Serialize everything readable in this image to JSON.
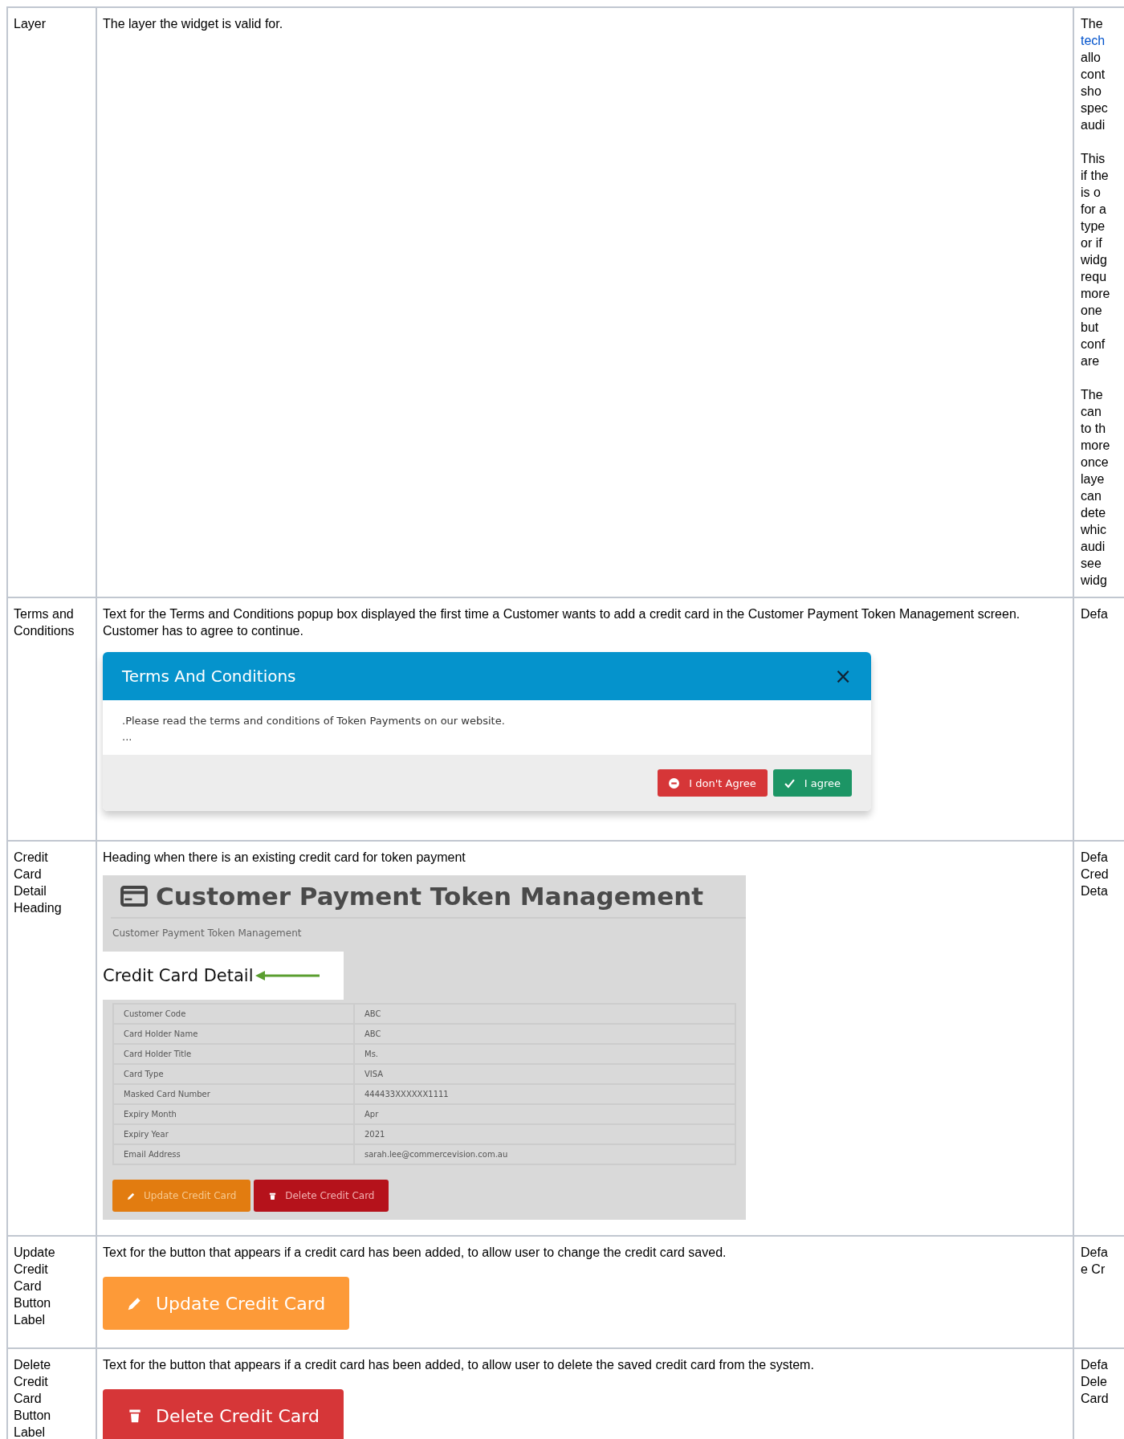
{
  "rows": [
    {
      "name": "Layer",
      "description": "The layer the widget is valid for.",
      "notes": [
        [
          {
            "text": "The",
            "link": false
          },
          {
            "text": "tech",
            "link": true
          },
          {
            "text": "allo",
            "link": false
          },
          {
            "text": "cont",
            "link": false
          },
          {
            "text": "sho",
            "link": false
          },
          {
            "text": "spec",
            "link": false
          },
          {
            "text": "audi",
            "link": false
          }
        ],
        [
          {
            "text": "This",
            "link": false
          },
          {
            "text": "if the",
            "link": false
          },
          {
            "text": "is o",
            "link": false
          },
          {
            "text": "for a",
            "link": false
          },
          {
            "text": "type",
            "link": false
          },
          {
            "text": "or if",
            "link": false
          },
          {
            "text": "widg",
            "link": false
          },
          {
            "text": "requ",
            "link": false
          },
          {
            "text": "more",
            "link": false
          },
          {
            "text": "one",
            "link": false
          },
          {
            "text": "but",
            "link": false
          },
          {
            "text": "conf",
            "link": false
          },
          {
            "text": "are",
            "link": false
          }
        ],
        [
          {
            "text": "The",
            "link": false
          },
          {
            "text": "can",
            "link": false
          },
          {
            "text": "to th",
            "link": false
          },
          {
            "text": "more",
            "link": false
          },
          {
            "text": "once",
            "link": false
          },
          {
            "text": "laye",
            "link": false
          },
          {
            "text": "can",
            "link": false
          },
          {
            "text": "dete",
            "link": false
          },
          {
            "text": "whic",
            "link": false
          },
          {
            "text": "audi",
            "link": false
          },
          {
            "text": "see",
            "link": false
          },
          {
            "text": "widg",
            "link": false
          }
        ]
      ]
    },
    {
      "name": "Terms and Conditions",
      "description": "Text for the Terms and Conditions popup box displayed the first time a Customer wants to add a credit card in the Customer Payment Token Management screen. Customer has to agree to continue.",
      "notes": [
        [
          {
            "text": "Defa",
            "link": false
          }
        ]
      ],
      "example": {
        "kind": "terms",
        "title": "Terms And Conditions",
        "close": "×",
        "body": ".Please read the terms and conditions of Token Payments on our website.",
        "body_more": "...",
        "buttons": [
          {
            "kind": "decline",
            "label": "I don't Agree"
          },
          {
            "kind": "accept",
            "label": "I agree"
          }
        ]
      }
    },
    {
      "name": "Credit Card Detail Heading",
      "description": "Heading when there is an existing credit card for token payment",
      "notes": [
        [
          {
            "text": "Defa",
            "link": false
          },
          {
            "text": "Cred",
            "link": false
          },
          {
            "text": "Deta",
            "link": false
          }
        ]
      ],
      "example": {
        "kind": "detail",
        "title": "Customer Payment Token Management",
        "breadcrumb": "Customer Payment Token Management",
        "heading": "Credit Card Detail",
        "fields": [
          {
            "label": "Customer Code",
            "value": "ABC"
          },
          {
            "label": "Card Holder Name",
            "value": "ABC"
          },
          {
            "label": "Card Holder Title",
            "value": "Ms."
          },
          {
            "label": "Card Type",
            "value": "VISA"
          },
          {
            "label": "Masked Card Number",
            "value": "444433XXXXXX1111"
          },
          {
            "label": "Expiry Month",
            "value": "Apr"
          },
          {
            "label": "Expiry Year",
            "value": "2021"
          },
          {
            "label": "Email Address",
            "value": "sarah.lee@commercevision.com.au"
          }
        ],
        "buttons": [
          {
            "kind": "update",
            "label": "Update Credit Card"
          },
          {
            "kind": "delete",
            "label": "Delete Credit Card"
          }
        ]
      }
    },
    {
      "name": "Update Credit Card Button Label",
      "description": "Text for the button that appears if a credit card has been added, to allow user to change the credit card saved.",
      "notes": [
        [
          {
            "text": "Defa",
            "link": false
          },
          {
            "text": "e Cr",
            "link": false
          }
        ]
      ],
      "example": {
        "kind": "button",
        "button": {
          "kind": "update",
          "label": "Update Credit Card"
        }
      }
    },
    {
      "name": "Delete Credit Card Button Label",
      "description": "Text for the button that appears if a credit card has been added, to allow user to delete the saved credit card from the system.",
      "notes": [
        [
          {
            "text": "Defa",
            "link": false
          },
          {
            "text": "Dele",
            "link": false
          },
          {
            "text": "Card",
            "link": false
          }
        ]
      ],
      "example": {
        "kind": "button",
        "button": {
          "kind": "delete",
          "label": "Delete Credit Card"
        }
      }
    }
  ]
}
